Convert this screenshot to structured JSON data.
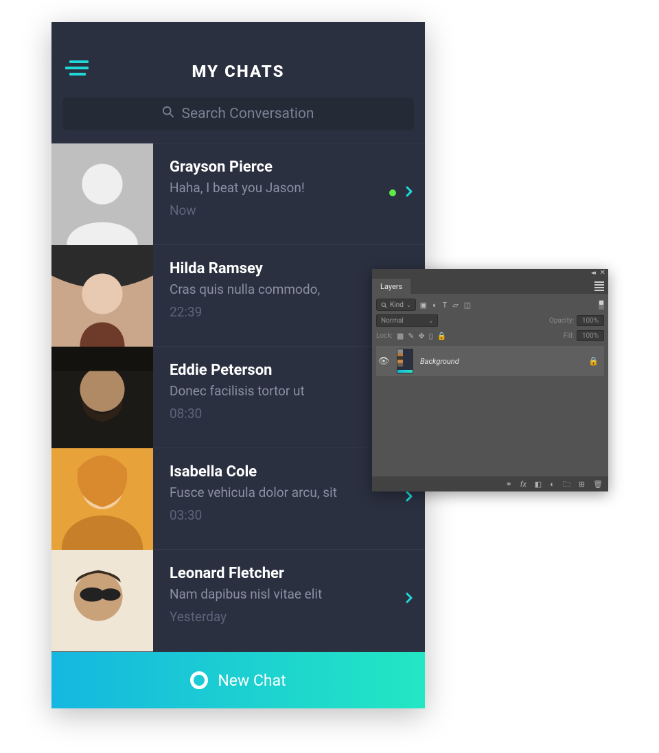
{
  "app": {
    "title": "MY CHATS",
    "search_placeholder": "Search Conversation",
    "new_chat_label": "New Chat"
  },
  "chats": [
    {
      "name": "Grayson Pierce",
      "preview": "Haha, I beat you Jason!",
      "time": "Now",
      "online": true,
      "chevron": true
    },
    {
      "name": "Hilda Ramsey",
      "preview": "Cras quis nulla commodo,",
      "time": "22:39",
      "online": false,
      "chevron": false
    },
    {
      "name": "Eddie Peterson",
      "preview": "Donec facilisis tortor ut",
      "time": "08:30",
      "online": false,
      "chevron": false
    },
    {
      "name": "Isabella Cole",
      "preview": "Fusce vehicula dolor arcu, sit",
      "time": "03:30",
      "online": false,
      "chevron": true
    },
    {
      "name": "Leonard Fletcher",
      "preview": "Nam dapibus nisl vitae elit",
      "time": "Yesterday",
      "online": false,
      "chevron": true
    }
  ],
  "ps": {
    "tab": "Layers",
    "kind_label": "Kind",
    "blend_mode": "Normal",
    "opacity_label": "Opacity:",
    "opacity_value": "100%",
    "lock_label": "Lock:",
    "fill_label": "Fill:",
    "fill_value": "100%",
    "layer_name": "Background"
  }
}
